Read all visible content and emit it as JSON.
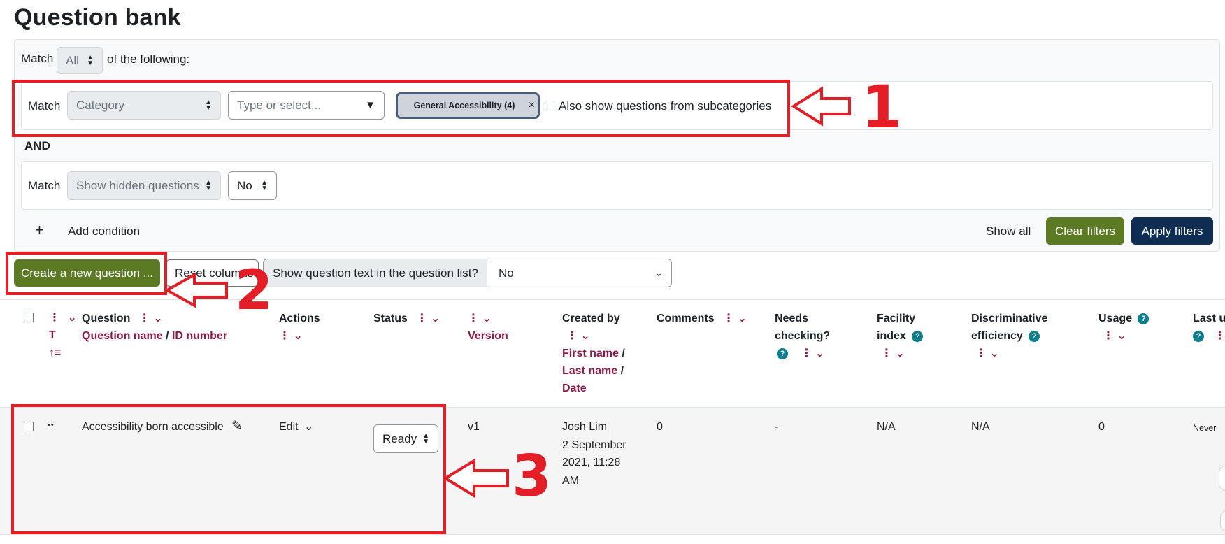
{
  "page": {
    "title": "Question bank"
  },
  "filters": {
    "match_label": "Match",
    "match_all_value": "All",
    "of_following": "of the following:",
    "category_condition": {
      "match_label": "Match",
      "field": "Category",
      "search_placeholder": "Type or select...",
      "selected_chip": "General Accessibility (4)",
      "chip_remove": "×",
      "subcategories_label": "Also show questions from subcategories"
    },
    "and_label": "AND",
    "hidden_condition": {
      "match_label": "Match",
      "field": "Show hidden questions",
      "value": "No"
    },
    "add_condition_icon": "+",
    "add_condition": "Add condition",
    "show_all": "Show all",
    "clear_filters": "Clear filters",
    "apply_filters": "Apply filters"
  },
  "toolbar": {
    "create_question": "Create a new question ...",
    "reset_columns": "Reset columns",
    "show_text_label": "Show question text in the question list?",
    "show_text_value": "No"
  },
  "table": {
    "headers": {
      "type_letter": "T",
      "sort_icon": "↑≡",
      "question": "Question",
      "question_name": "Question name",
      "id_number": "ID number",
      "actions": "Actions",
      "status": "Status",
      "version": "Version",
      "created_by": "Created by",
      "first_name": "First name",
      "last_name": "Last name",
      "date": "Date",
      "comments": "Comments",
      "needs_checking_1": "Needs",
      "needs_checking_2": "checking?",
      "facility_1": "Facility",
      "facility_2": "index",
      "discriminative_1": "Discriminative",
      "discriminative_2": "efficiency",
      "usage": "Usage",
      "last_used": "Last u",
      "slash": "/",
      "help": "?",
      "kebab": "⋮",
      "chevron": "⌄"
    },
    "row": {
      "drag_icon": "••",
      "name": "Accessibility born accessible",
      "edit": "Edit",
      "status": "Ready",
      "version": "v1",
      "created_line1": "Josh Lim",
      "created_line2": "2 September",
      "created_line3": "2021, 11:28",
      "created_line4": "AM",
      "comments": "0",
      "needs_checking": "-",
      "facility": "N/A",
      "discriminative": "N/A",
      "usage": "0",
      "last_used": "Never"
    }
  },
  "annotations": {
    "one": "1",
    "two": "2",
    "three": "3"
  },
  "colors": {
    "accent_red": "#e41e26",
    "link_maroon": "#8b1b4a",
    "button_green": "#5b7a23",
    "button_navy": "#0f2d52",
    "help_teal": "#0b7f8d"
  }
}
